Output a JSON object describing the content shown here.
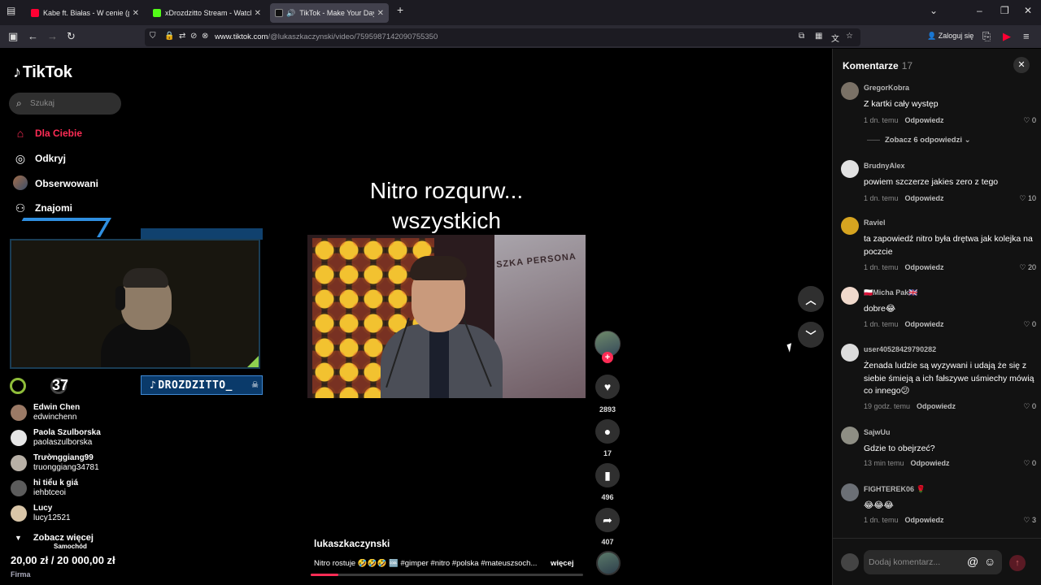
{
  "browser": {
    "tabs": [
      {
        "title": "Kabe ft. Białas - W cenie (prod.",
        "favicon_color": "#ff0033",
        "favicon": "youtube-icon"
      },
      {
        "title": "xDrozdzitto Stream - Watch Liv",
        "favicon_color": "#53fc18",
        "favicon": "kick-icon"
      },
      {
        "title": "TikTok - Make Your Day",
        "favicon_color": "#ffffff",
        "favicon": "tiktok-icon"
      }
    ],
    "url_domain": "www.tiktok.com",
    "url_path": "/@lukaszkaczynski/video/7595987142090755350",
    "login_label": "Zaloguj się"
  },
  "sidebar": {
    "logo": "TikTok",
    "search_placeholder": "Szukaj",
    "nav": [
      {
        "label": "Dla Ciebie",
        "icon": "home-icon"
      },
      {
        "label": "Odkryj",
        "icon": "compass-icon"
      },
      {
        "label": "Obserwowani",
        "icon": "avatar"
      },
      {
        "label": "Znajomi",
        "icon": "friends-icon"
      }
    ],
    "stream_nameplate": "DROZDZITTO_",
    "stream_counter": "37",
    "accounts": [
      {
        "name": "Edwin Chen",
        "handle": "edwinchenn"
      },
      {
        "name": "Paola Szulborska",
        "handle": "paolaszulborska"
      },
      {
        "name": "Trườnggiang99",
        "handle": "truonggiang34781"
      },
      {
        "name": "hỉ tiểu k giá",
        "handle": "iehbtceoi"
      },
      {
        "name": "Lucy",
        "handle": "lucy12521"
      }
    ],
    "see_more": "Zobacz więcej",
    "overlay_sub": "Samochód",
    "overlay_price": "20,00 zł / 20 000,00 zł",
    "overlay_firma": "Firma"
  },
  "video": {
    "title_line1": "Nitro rozqurw...",
    "title_line2": "wszystkich",
    "banner_text": "SZKA PERSONA",
    "author": "lukaszkaczynski",
    "caption": "Nitro rostuje 🤣🤣🤣 🆒 #gimper #nitro #polska #mateuszsoch...",
    "caption_more": "więcej",
    "progress": 0.1,
    "likes": "2893",
    "comments": "17",
    "saves": "496",
    "shares": "407"
  },
  "comments_panel": {
    "title": "Komentarze",
    "count": "17",
    "see_replies": "Zobacz 6 odpowiedzi",
    "reply_label": "Odpowiedz",
    "input_placeholder": "Dodaj komentarz...",
    "items": [
      {
        "user": "GregorKobra",
        "text": "Z kartki cały występ",
        "time": "1 dn. temu",
        "likes": "0"
      },
      {
        "user": "BrudnyAlex",
        "text": "powiem szczerze jakies zero z tego",
        "time": "1 dn. temu",
        "likes": "10"
      },
      {
        "user": "Raviel",
        "text": "ta zapowiedź nitro była drętwa jak kolejka na poczcie",
        "time": "1 dn. temu",
        "likes": "20"
      },
      {
        "user": "🇵🇱Micha Pak🇬🇧",
        "text": "dobre😂",
        "time": "1 dn. temu",
        "likes": "0"
      },
      {
        "user": "user40528429790282",
        "text": "Żenada ludzie są wyzywani i udają że się z siebie śmieją a ich fałszywe uśmiechy mówią co innego😕",
        "time": "19 godz. temu",
        "likes": "0"
      },
      {
        "user": "SajwUu",
        "text": "Gdzie to obejrzeć?",
        "time": "13 min temu",
        "likes": "0"
      },
      {
        "user": "FIGHTEREK06 🌹",
        "text": "😂😂😂",
        "time": "1 dn. temu",
        "likes": "3"
      }
    ]
  }
}
